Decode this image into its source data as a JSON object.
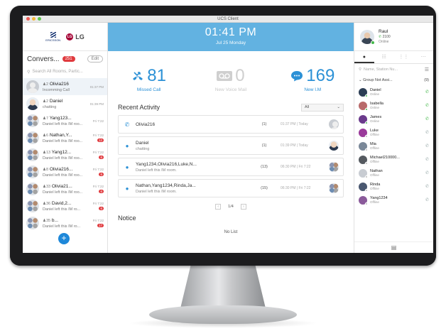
{
  "window": {
    "title": "UCS Client"
  },
  "left": {
    "conversations_title": "Convers...",
    "unread_badge": "251",
    "edit_label": "Edit",
    "search_placeholder": "Search All Rooms, Partic...",
    "items": [
      {
        "count": "2",
        "name": "Olivia216",
        "sub": "Incomming Call",
        "time": "01:37 PM",
        "unread": "",
        "avatar": "person"
      },
      {
        "count": "2",
        "name": "Daniel",
        "sub": "chatting",
        "time": "01:39 PM",
        "unread": "",
        "avatar": "photo"
      },
      {
        "count": "7",
        "name": "Yang123...",
        "sub": "Daniel left this IM roo...",
        "time": "Fri 7:22",
        "unread": "",
        "avatar": "grp"
      },
      {
        "count": "6",
        "name": "Nathan,Y...",
        "sub": "Daniel left this IM roo...",
        "time": "Fri 7:22",
        "unread": "12",
        "avatar": "grp"
      },
      {
        "count": "13",
        "name": "Yang12...",
        "sub": "Daniel left this IM roo...",
        "time": "Fri 7:22",
        "unread": "6",
        "avatar": "grp"
      },
      {
        "count": "8",
        "name": "Olivia216...",
        "sub": "Daniel left this IM roo...",
        "time": "Fri 7:22",
        "unread": "6",
        "avatar": "grp"
      },
      {
        "count": "33",
        "name": "Olivia21...",
        "sub": "Daniel left this IM roo...",
        "time": "Fri 7:22",
        "unread": "6",
        "avatar": "grp"
      },
      {
        "count": "36",
        "name": "David,2...",
        "sub": "Daniel left this IM ro...",
        "time": "Fri 7:22",
        "unread": "6",
        "avatar": "grp"
      },
      {
        "count": "35",
        "name": "b...",
        "sub": "Daniel left this IM ro...",
        "time": "Fri 7:22",
        "unread": "17",
        "avatar": "grp"
      }
    ]
  },
  "clock": {
    "time": "01:41 PM",
    "date": "Jul 25 Monday"
  },
  "stats": [
    {
      "value": "81",
      "label": "Missed Call",
      "dim": false
    },
    {
      "value": "0",
      "label": "New Voice Mail",
      "dim": true
    },
    {
      "value": "169",
      "label": "New I.M",
      "dim": false
    }
  ],
  "recent": {
    "title": "Recent Activity",
    "filter": "All",
    "items": [
      {
        "name": "Olivia216",
        "sub": "",
        "count": "(1)",
        "time": "01:37 PM",
        "day": "Today",
        "icon": "call"
      },
      {
        "name": "Daniel",
        "sub": "chatting",
        "count": "(1)",
        "time": "01:39 PM",
        "day": "Today",
        "icon": "chat"
      },
      {
        "name": "Yang1234,Olivia216,Luke,N...",
        "sub": "Daniel left this IM room.",
        "count": "(13)",
        "time": "06:30 PM",
        "day": "Fri 7:22",
        "icon": "chat"
      },
      {
        "name": "Nathan,Yang1234,Rinda,Ja...",
        "sub": "Daniel left this IM room.",
        "count": "(15)",
        "time": "06:30 PM",
        "day": "Fri 7:22",
        "icon": "chat"
      }
    ],
    "page": "1/4"
  },
  "notice": {
    "title": "Notice",
    "empty": "No List"
  },
  "me": {
    "name": "Raul",
    "ext": "2100",
    "status": "Online"
  },
  "right": {
    "search_placeholder": "Name, Station Nu...",
    "group_name": "Group Not Assi...",
    "group_count": "(9)",
    "contacts": [
      {
        "name": "Daniel",
        "status": "Online",
        "color": "#2c3e55",
        "dot": "#44b84a"
      },
      {
        "name": "Isabella",
        "status": "Online",
        "color": "#b86a6a",
        "dot": "#44b84a"
      },
      {
        "name": "James",
        "status": "Online",
        "color": "#6b3a8c",
        "dot": "#44b84a"
      },
      {
        "name": "Luke",
        "status": "Offline",
        "color": "#9a3a9a",
        "dot": "#bbbbbb"
      },
      {
        "name": "Mia",
        "status": "Offline",
        "color": "#7a8898",
        "dot": "#bbbbbb"
      },
      {
        "name": "Michael210000...",
        "status": "Offline",
        "color": "#555a60",
        "dot": "#bbbbbb"
      },
      {
        "name": "Nathan",
        "status": "Offline",
        "color": "#c8ccd2",
        "dot": "#bbbbbb"
      },
      {
        "name": "Rinda",
        "status": "Offline",
        "color": "#4a5870",
        "dot": "#bbbbbb"
      },
      {
        "name": "Yang1234",
        "status": "Offline",
        "color": "#8a5a9a",
        "dot": "#bbbbbb"
      }
    ]
  },
  "colors": {
    "accent": "#2c91d6",
    "header": "#62b2e1",
    "badge": "#e03a3e",
    "online": "#44b84a"
  }
}
